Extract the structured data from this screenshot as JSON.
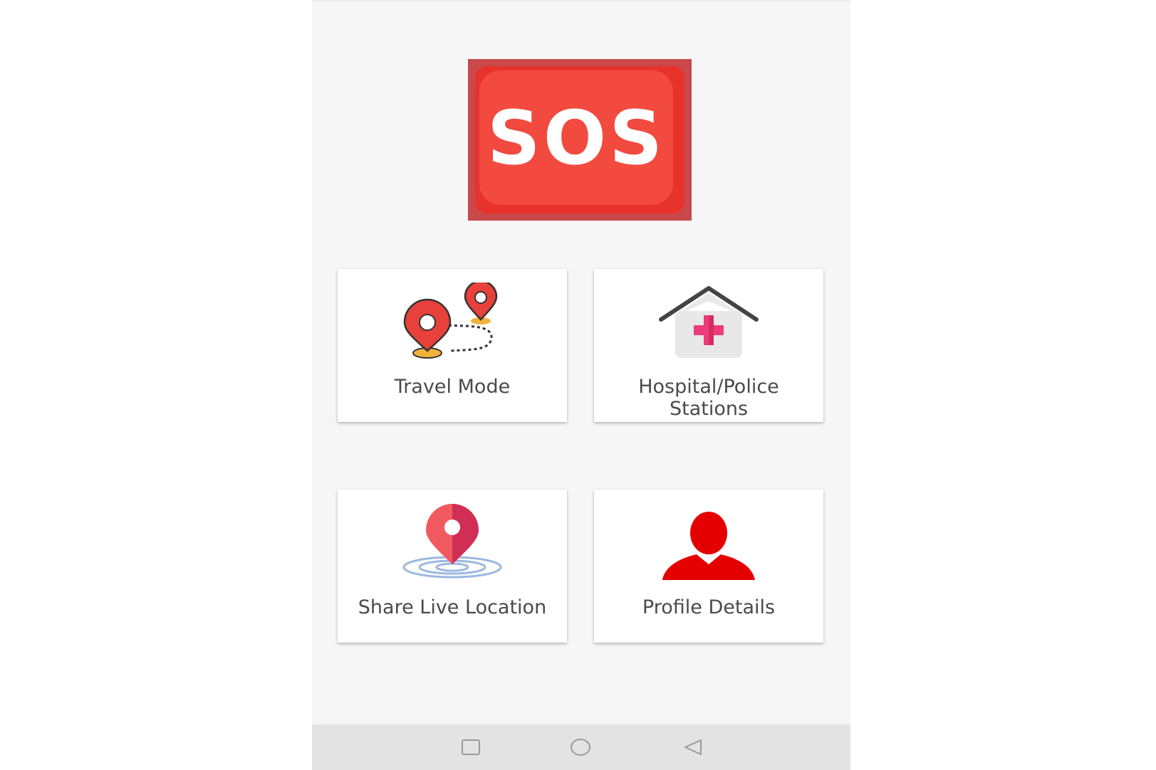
{
  "sos": {
    "label": "SOS",
    "color": "#f24a3f",
    "border_color": "#c94849"
  },
  "tiles": [
    {
      "label": "Travel Mode",
      "icon": "route-pins-icon"
    },
    {
      "label_line1": "Hospital/Police",
      "label_line2": "Stations",
      "icon": "hospital-icon"
    },
    {
      "label": "Share Live Location",
      "icon": "location-pin-icon"
    },
    {
      "label": "Profile Details",
      "icon": "user-icon"
    }
  ],
  "navbar": {
    "recents_icon": "square-icon",
    "home_icon": "circle-icon",
    "back_icon": "triangle-back-icon"
  },
  "colors": {
    "accent_red": "#e52d2d",
    "background": "#f6f6f6",
    "card": "#ffffff",
    "text": "#4a4a4a"
  }
}
